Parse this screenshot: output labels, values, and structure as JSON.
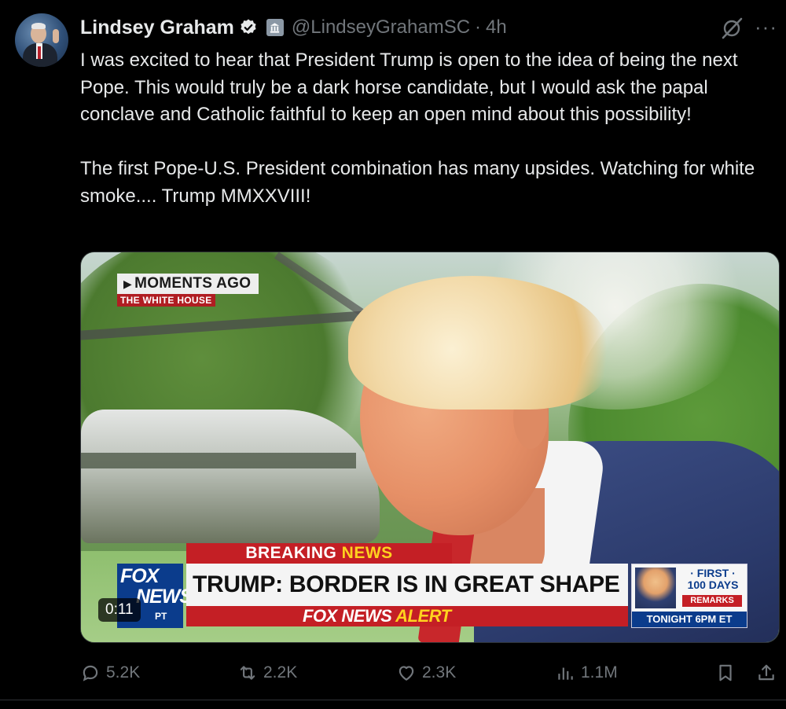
{
  "tweet": {
    "author_name": "Lindsey Graham",
    "handle": "@LindseyGrahamSC",
    "separator": "·",
    "time": "4h",
    "more_label": "···",
    "text": "I was excited to hear that President Trump is open to the idea of being the next Pope. This would truly be a dark horse candidate, but I would ask the papal conclave and Catholic faithful to keep an open mind about this possibility!\n\nThe first Pope-U.S. President combination has many upsides. Watching for white smoke.... Trump MMXXVIII!"
  },
  "video": {
    "duration": "0:11",
    "chyron": {
      "moments_ago": "MOMENTS AGO",
      "location": "THE WHITE HOUSE",
      "breaking": "BREAKING",
      "news": "NEWS",
      "headline": "TRUMP: BORDER IS IN GREAT SHAPE",
      "network_logo_line1": "FOX",
      "network_logo_line2": "NEWS",
      "network_logo_line3": "PT",
      "alert_prefix": "FOX NEWS",
      "alert_word": "ALERT",
      "promo_line1": "· FIRST ·",
      "promo_line2": "100 DAYS",
      "promo_line3": "REMARKS",
      "promo_time": "TONIGHT 6PM ET"
    }
  },
  "actions": {
    "replies": "5.2K",
    "reposts": "2.2K",
    "likes": "2.3K",
    "views": "1.1M"
  },
  "colors": {
    "background": "#000000",
    "text": "#e7e9ea",
    "secondary": "#71767b",
    "verified": "#1d9bf0",
    "fox_red": "#c41f25",
    "fox_blue": "#0b3c8c"
  },
  "icons": [
    "verified-badge-icon",
    "government-badge-icon",
    "grok-icon",
    "more-icon",
    "reply-icon",
    "repost-icon",
    "like-icon",
    "views-icon",
    "bookmark-icon",
    "share-icon"
  ]
}
